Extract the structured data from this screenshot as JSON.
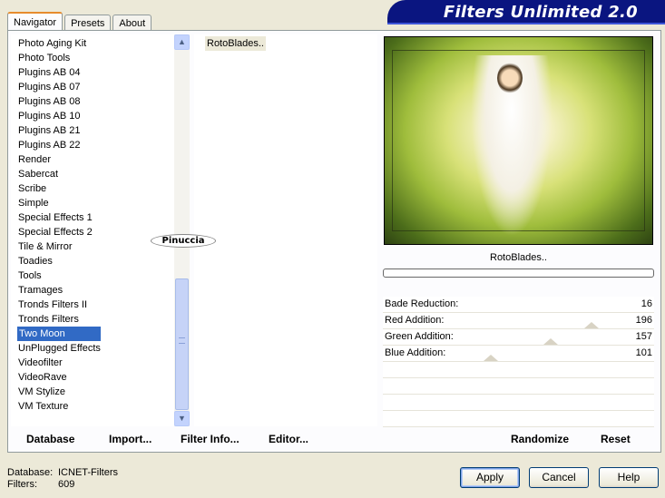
{
  "tabs": [
    "Navigator",
    "Presets",
    "About"
  ],
  "brand_title": "Filters Unlimited 2.0",
  "categories": [
    "Photo Aging Kit",
    "Photo Tools",
    "Plugins AB 04",
    "Plugins AB 07",
    "Plugins AB 08",
    "Plugins AB 10",
    "Plugins AB 21",
    "Plugins AB 22",
    "Render",
    "Sabercat",
    "Scribe",
    "Simple",
    "Special Effects 1",
    "Special Effects 2",
    "Tile & Mirror",
    "Toadies",
    "Tools",
    "Tramages",
    "Tronds Filters II",
    "Tronds Filters",
    "Two Moon",
    "UnPlugged Effects",
    "Videofilter",
    "VideoRave",
    "VM Stylize",
    "VM Texture"
  ],
  "selected_category": "Two Moon",
  "filter_item": "RotoBlades..",
  "preview_filter_name": "RotoBlades..",
  "watermark": "Pinuccia",
  "params": [
    {
      "label": "Bade Reduction:",
      "value": "16"
    },
    {
      "label": "Red Addition:",
      "value": "196"
    },
    {
      "label": "Green Addition:",
      "value": "157"
    },
    {
      "label": "Blue Addition:",
      "value": "101"
    }
  ],
  "bottom_buttons": {
    "database": "Database",
    "import": "Import...",
    "filter_info": "Filter Info...",
    "editor": "Editor...",
    "randomize": "Randomize",
    "reset": "Reset"
  },
  "info": {
    "database_label": "Database:",
    "database_value": "ICNET-Filters",
    "filters_label": "Filters:",
    "filters_value": "609"
  },
  "dialog_buttons": {
    "apply": "Apply",
    "cancel": "Cancel",
    "help": "Help"
  }
}
